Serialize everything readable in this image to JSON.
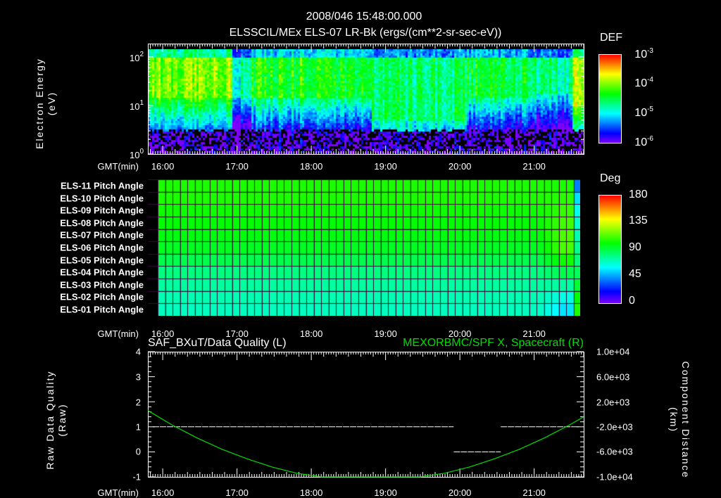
{
  "header": {
    "datetime": "2008/046 15:48:00.000",
    "title": "ELSSCIL/MEx ELS-07 LR-Bk  (ergs/(cm**2-sr-sec-eV))"
  },
  "time_axis": {
    "label": "GMT(min)",
    "unit": "minutes after 16:00",
    "range": [
      -12,
      340
    ],
    "ticks": [
      0,
      60,
      120,
      180,
      240,
      300
    ],
    "tick_labels": [
      "16:00",
      "17:00",
      "18:00",
      "19:00",
      "20:00",
      "21:00"
    ]
  },
  "chart_data": [
    {
      "type": "heatmap",
      "name": "electron-spectrogram",
      "ylabel_line1": "Electron Energy",
      "ylabel_line2": "(eV)",
      "y_scale": "log",
      "ylim_log10": [
        0,
        2.16
      ],
      "y_tick_labels": [
        {
          "base": "10",
          "exp": "0"
        },
        {
          "base": "10",
          "exp": "1"
        },
        {
          "base": "10",
          "exp": "2"
        }
      ],
      "colorbar": {
        "title": "DEF",
        "scale": "log",
        "range_log10": [
          -6,
          -3
        ],
        "tick_labels": [
          {
            "base": "10",
            "exp": "-3"
          },
          {
            "base": "10",
            "exp": "-4"
          },
          {
            "base": "10",
            "exp": "-5"
          },
          {
            "base": "10",
            "exp": "-6"
          }
        ]
      },
      "segments": [
        {
          "start": -12,
          "end": 55,
          "peak_log_def": -4.0,
          "band_low_log_e": 1.2
        },
        {
          "start": 55,
          "end": 70,
          "peak_log_def": -4.8,
          "band_low_log_e": 1.2
        },
        {
          "start": 70,
          "end": 168,
          "peak_log_def": -4.35,
          "band_low_log_e": 1.2
        },
        {
          "start": 168,
          "end": 245,
          "peak_log_def": -4.6,
          "band_low_log_e": 0.7
        },
        {
          "start": 245,
          "end": 300,
          "peak_log_def": -4.45,
          "band_low_log_e": 1.2
        },
        {
          "start": 300,
          "end": 330,
          "peak_log_def": -4.7,
          "band_low_log_e": 1.25
        },
        {
          "start": 330,
          "end": 340,
          "peak_log_def": -3.8,
          "band_low_log_e": 1.0
        }
      ]
    },
    {
      "type": "heatmap",
      "name": "pitch-angle",
      "rows": [
        "ELS-11 Pitch Angle",
        "ELS-10 Pitch Angle",
        "ELS-09 Pitch Angle",
        "ELS-08 Pitch Angle",
        "ELS-07 Pitch Angle",
        "ELS-06 Pitch Angle",
        "ELS-05 Pitch Angle",
        "ELS-04 Pitch Angle",
        "ELS-03 Pitch Angle",
        "ELS-02 Pitch Angle",
        "ELS-01 Pitch Angle"
      ],
      "row_values_deg": [
        104,
        104,
        102,
        100,
        98,
        95,
        88,
        80,
        75,
        72,
        70
      ],
      "late_shift_deg": [
        0,
        2,
        6,
        10,
        14,
        16,
        14,
        8,
        0,
        -8,
        -14
      ],
      "edge_values_deg": [
        40,
        55,
        62,
        68,
        72,
        78,
        82,
        86,
        92,
        100,
        104
      ],
      "cell_minutes": 6,
      "colorbar": {
        "title": "Deg",
        "range": [
          0,
          180
        ],
        "tick_labels": [
          "180",
          "135",
          "90",
          "45",
          "0"
        ]
      }
    },
    {
      "type": "line",
      "name": "data-quality-and-position",
      "title_left": "SAF_BXuT/Data Quality (L)",
      "title_right": "MEXORBMC/SPF X, Spacecraft (R)",
      "ylabel_left_line1": "Raw Data Quality",
      "ylabel_left_line2": "(Raw)",
      "ylabel_right_line1": "Component Distance",
      "ylabel_right_line2": "(km)",
      "ylim_left": [
        -1,
        4
      ],
      "y_left_ticks": [
        "4",
        "3",
        "2",
        "1",
        "0",
        "-1"
      ],
      "ylim_right": [
        -10000,
        10000
      ],
      "y_right_ticks": [
        "1.0e+04",
        "6.0e+03",
        "2.0e+03",
        "-2.0e+03",
        "-6.0e+03",
        "-1.0e+04"
      ],
      "quality_series": [
        {
          "start": -8,
          "end": 235,
          "value": 1
        },
        {
          "start": 235,
          "end": 273,
          "value": 0
        },
        {
          "start": 273,
          "end": 336,
          "value": 1
        }
      ],
      "position_series": {
        "x": [
          -12,
          8,
          28,
          48,
          68,
          88,
          108,
          128,
          148,
          168,
          188,
          208,
          228,
          248,
          268,
          288,
          308,
          328,
          340
        ],
        "y": [
          600,
          -1750,
          -3800,
          -5600,
          -7100,
          -8400,
          -9400,
          -10000,
          -10500,
          -10600,
          -10500,
          -10000,
          -9400,
          -8400,
          -7100,
          -5600,
          -3800,
          -1750,
          -400
        ]
      },
      "colors": {
        "quality": "#ffffff",
        "position": "#00dd00"
      }
    }
  ]
}
